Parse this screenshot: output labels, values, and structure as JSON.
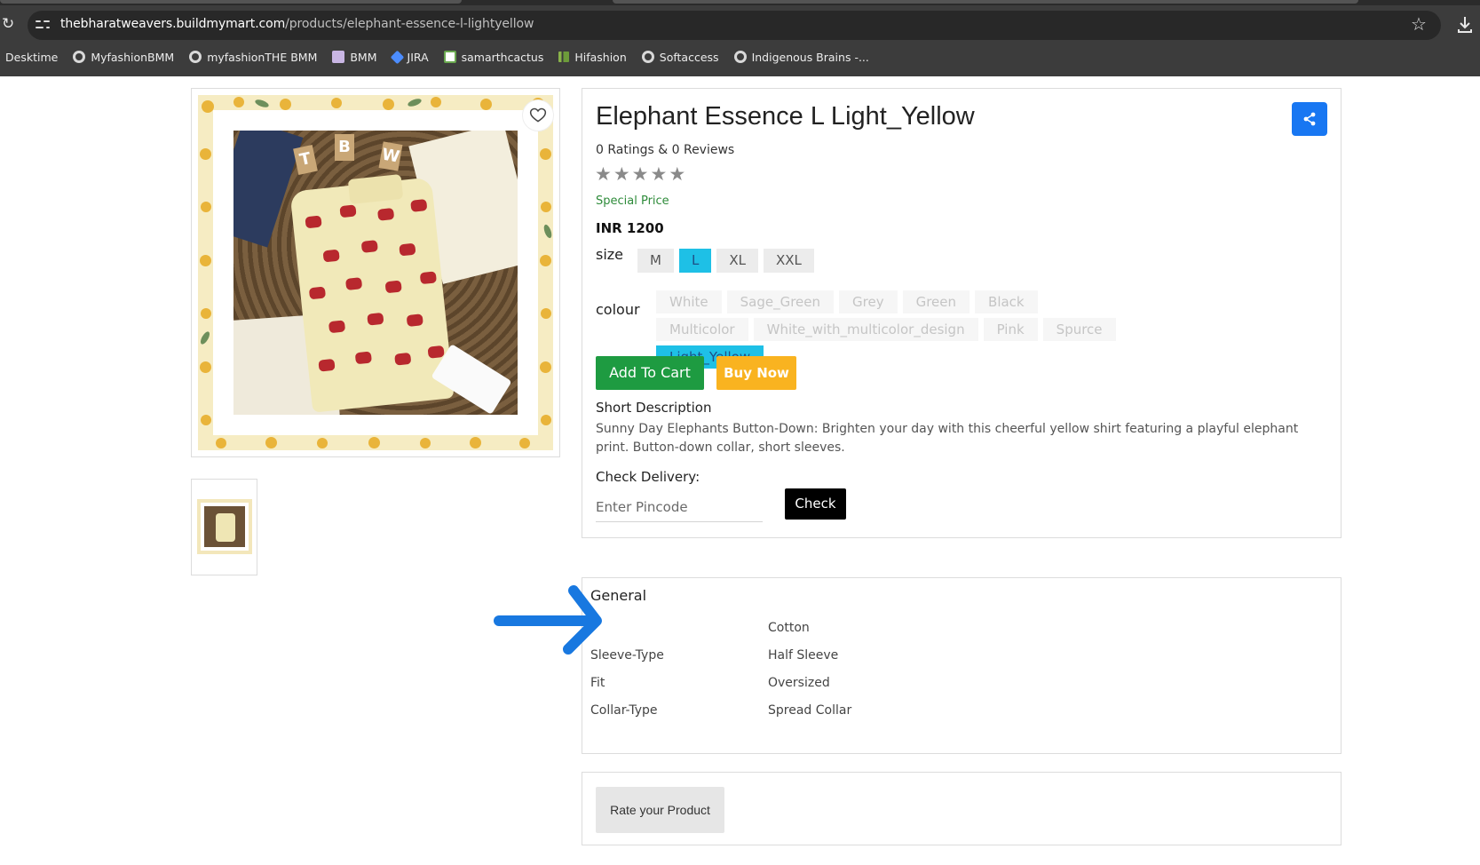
{
  "browser": {
    "url_host": "thebharatweavers.buildmymart.com",
    "url_path": "/products/elephant-essence-l-lightyellow",
    "bookmarks": [
      {
        "label": "Desktime",
        "icon": "none"
      },
      {
        "label": "MyfashionBMM",
        "icon": "globe-icon"
      },
      {
        "label": "myfashionTHE BMM",
        "icon": "globe-icon"
      },
      {
        "label": "BMM",
        "icon": "bmm-icon"
      },
      {
        "label": "JIRA",
        "icon": "jira-icon"
      },
      {
        "label": "samarthcactus",
        "icon": "cactus-icon"
      },
      {
        "label": "Hifashion",
        "icon": "hifashion-icon"
      },
      {
        "label": "Softaccess",
        "icon": "globe-icon"
      },
      {
        "label": "Indigenous Brains -...",
        "icon": "globe-icon"
      }
    ]
  },
  "product": {
    "title": "Elephant Essence L Light_Yellow",
    "ratings_text": "0 Ratings & 0 Reviews",
    "stars": [
      "★",
      "★",
      "★",
      "★",
      "★"
    ],
    "special_price_label": "Special Price",
    "price": "INR 1200",
    "size_label": "size",
    "sizes": [
      "M",
      "L",
      "XL",
      "XXL"
    ],
    "selected_size": "L",
    "colour_label": "colour",
    "colours": [
      "White",
      "Sage_Green",
      "Grey",
      "Green",
      "Black",
      "Multicolor",
      "White_with_multicolor_design",
      "Pink",
      "Spurce",
      "Light_Yellow"
    ],
    "selected_colour": "Light_Yellow",
    "add_to_cart_label": "Add To Cart",
    "buy_now_label": "Buy Now",
    "short_description_title": "Short Description",
    "short_description": "Sunny Day Elephants Button-Down: Brighten your day with this cheerful yellow shirt featuring a playful elephant print. Button-down collar, short sleeves.",
    "check_delivery_title": "Check Delivery:",
    "pincode_placeholder": "Enter Pincode",
    "check_label": "Check"
  },
  "general": {
    "title": "General",
    "specs": [
      {
        "key": "",
        "value": "Cotton"
      },
      {
        "key": "Sleeve-Type",
        "value": "Half Sleeve"
      },
      {
        "key": "Fit",
        "value": "Oversized"
      },
      {
        "key": "Collar-Type",
        "value": "Spread Collar"
      }
    ]
  },
  "rating": {
    "rate_button_label": "Rate your Product"
  },
  "colors": {
    "accent_blue": "#1ec0e6",
    "share_blue": "#1877f2",
    "cart_green": "#1e9b41",
    "buy_orange": "#f9b320",
    "annotation_arrow": "#1877f2"
  }
}
